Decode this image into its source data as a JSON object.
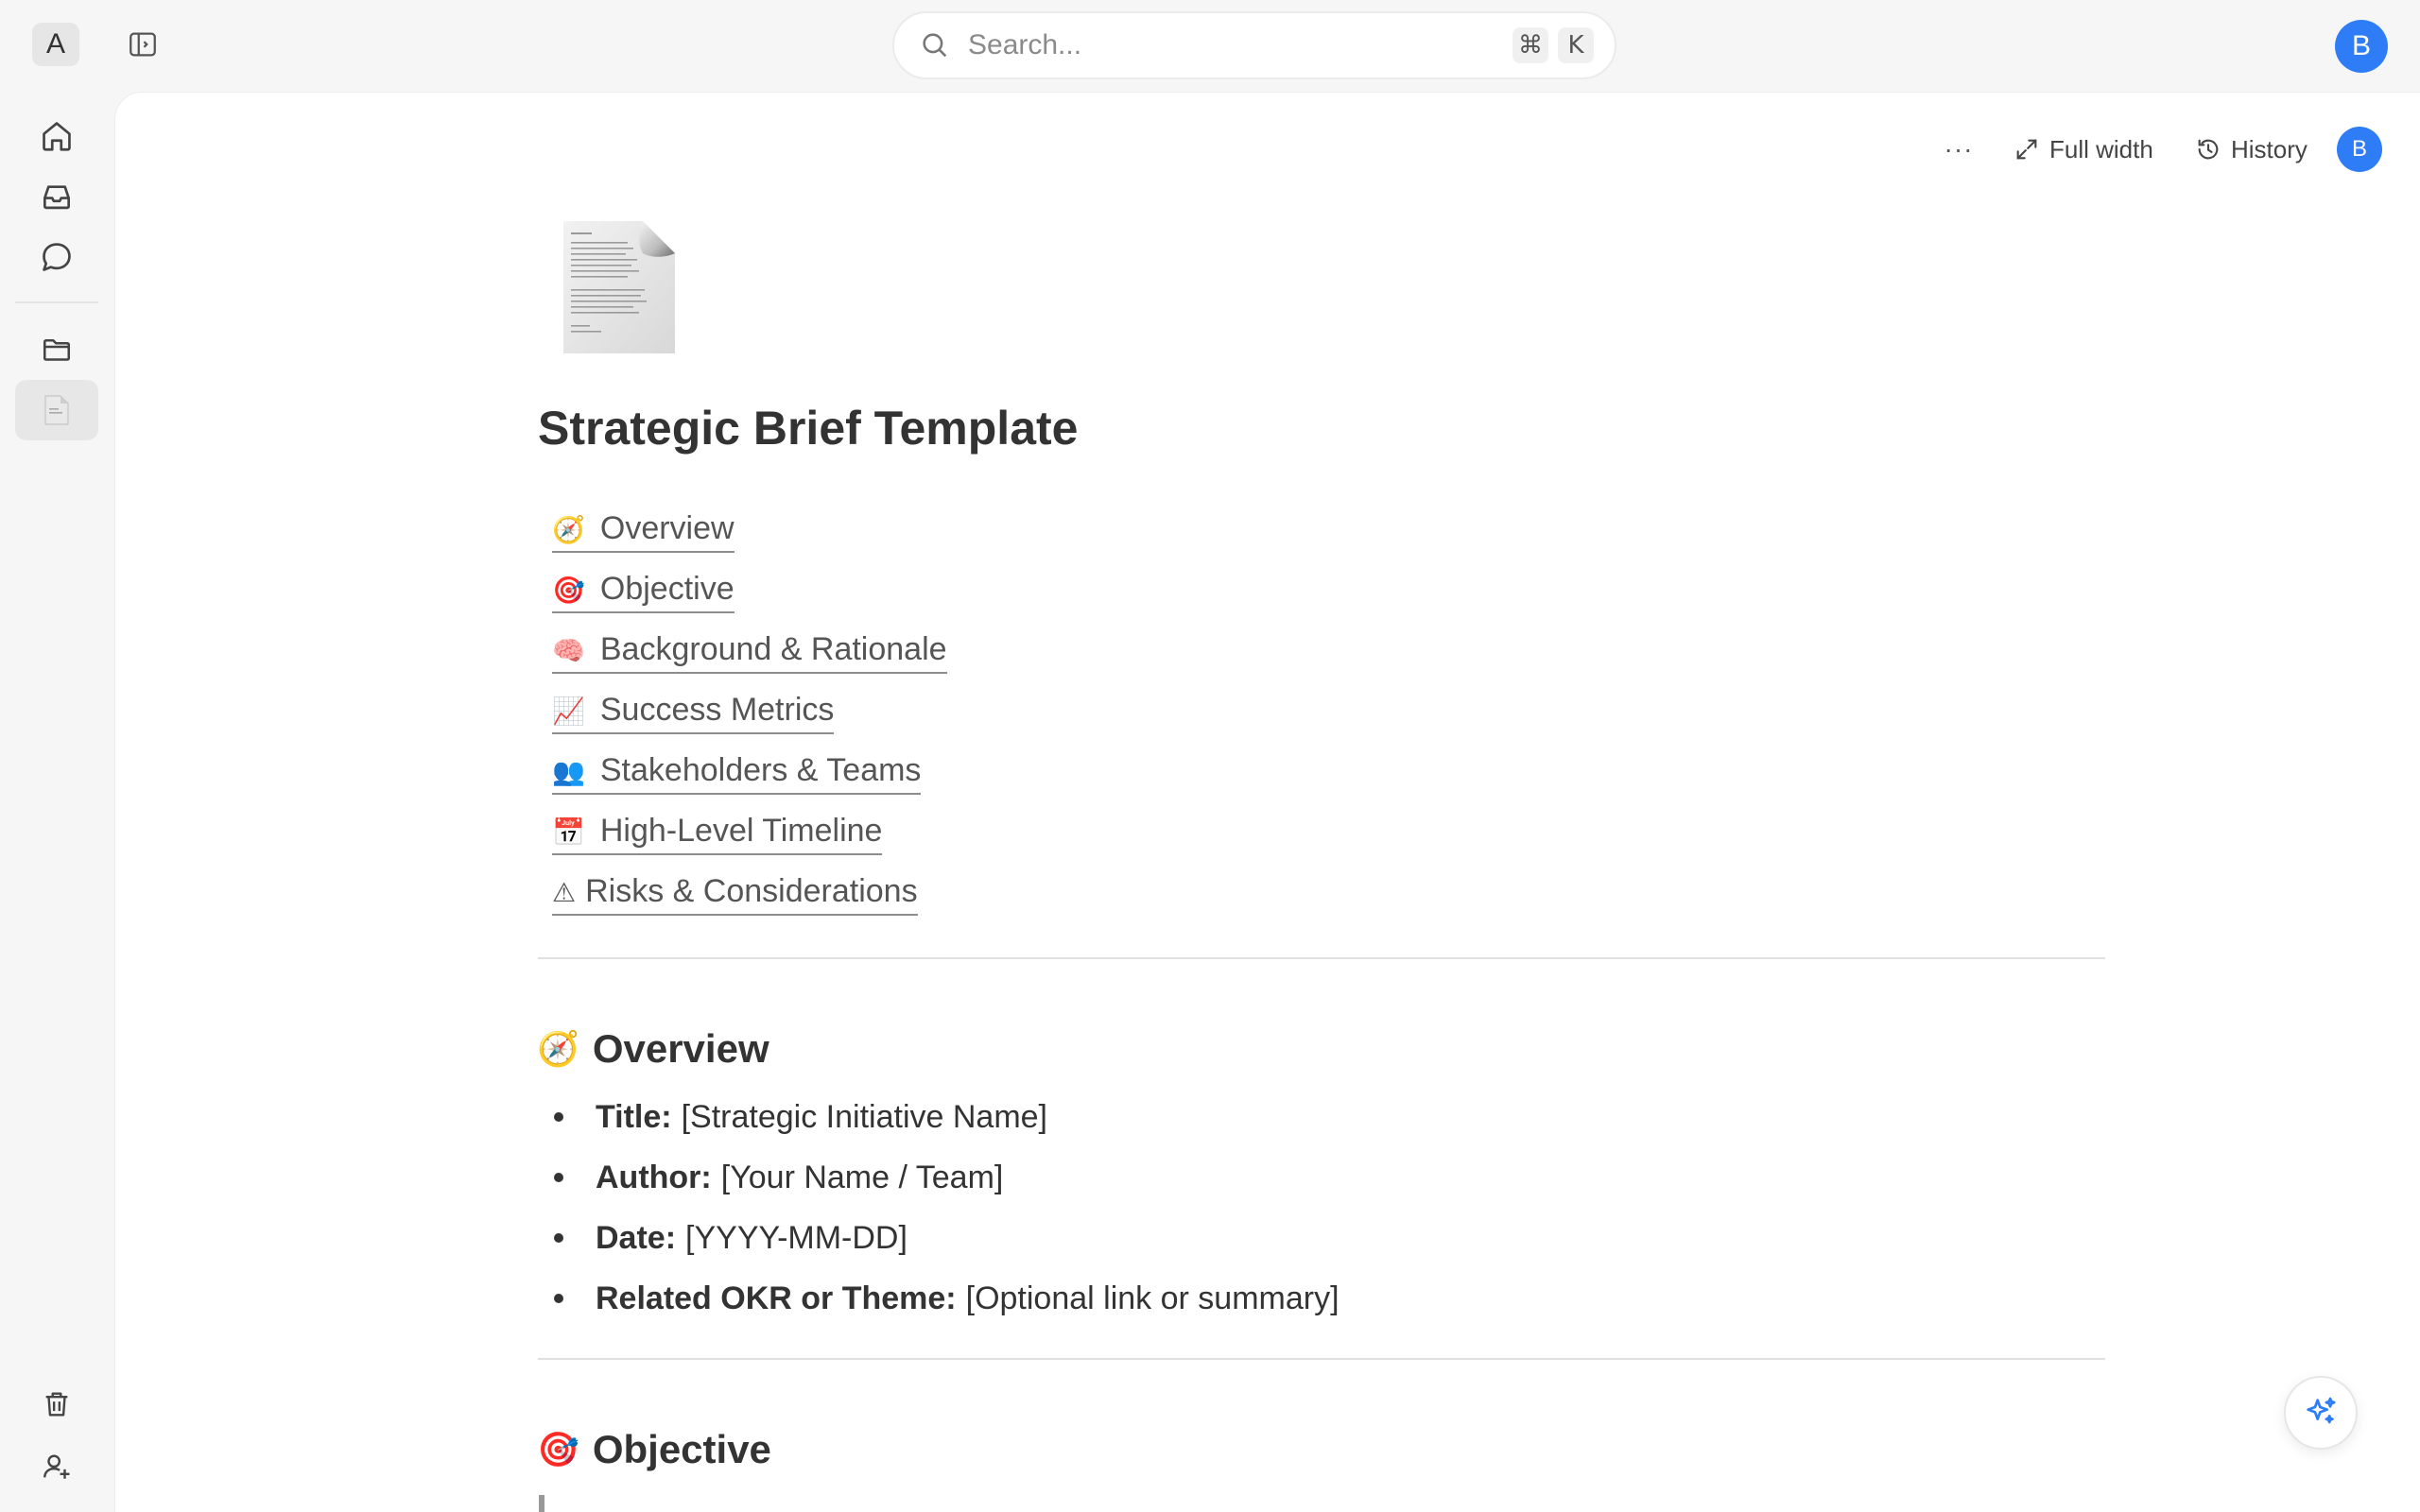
{
  "workspace": {
    "initial": "A"
  },
  "search": {
    "placeholder": "Search...",
    "shortcut_mod": "⌘",
    "shortcut_key": "K"
  },
  "user": {
    "initial": "B"
  },
  "toolbar": {
    "more_label": "···",
    "full_width_label": "Full width",
    "history_label": "History"
  },
  "document": {
    "title": "Strategic Brief Template",
    "toc": [
      {
        "emoji": "🧭",
        "label": "Overview"
      },
      {
        "emoji": "🎯",
        "label": "Objective"
      },
      {
        "emoji": "🧠",
        "label": "Background & Rationale"
      },
      {
        "emoji": "📈",
        "label": "Success Metrics"
      },
      {
        "emoji": "👥",
        "label": "Stakeholders & Teams"
      },
      {
        "emoji": "📅",
        "label": "High-Level Timeline"
      },
      {
        "emoji": "⚠",
        "label": "Risks & Considerations"
      }
    ],
    "overview": {
      "emoji": "🧭",
      "heading": "Overview",
      "items": [
        {
          "label": "Title:",
          "value": "[Strategic Initiative Name]"
        },
        {
          "label": "Author:",
          "value": "[Your Name / Team]"
        },
        {
          "label": "Date:",
          "value": "[YYYY-MM-DD]"
        },
        {
          "label": "Related OKR or Theme:",
          "value": "[Optional link or summary]"
        }
      ]
    },
    "objective": {
      "emoji": "🎯",
      "heading": "Objective"
    }
  },
  "colors": {
    "accent": "#2f7df6",
    "background": "#f6f6f6",
    "surface": "#ffffff"
  }
}
